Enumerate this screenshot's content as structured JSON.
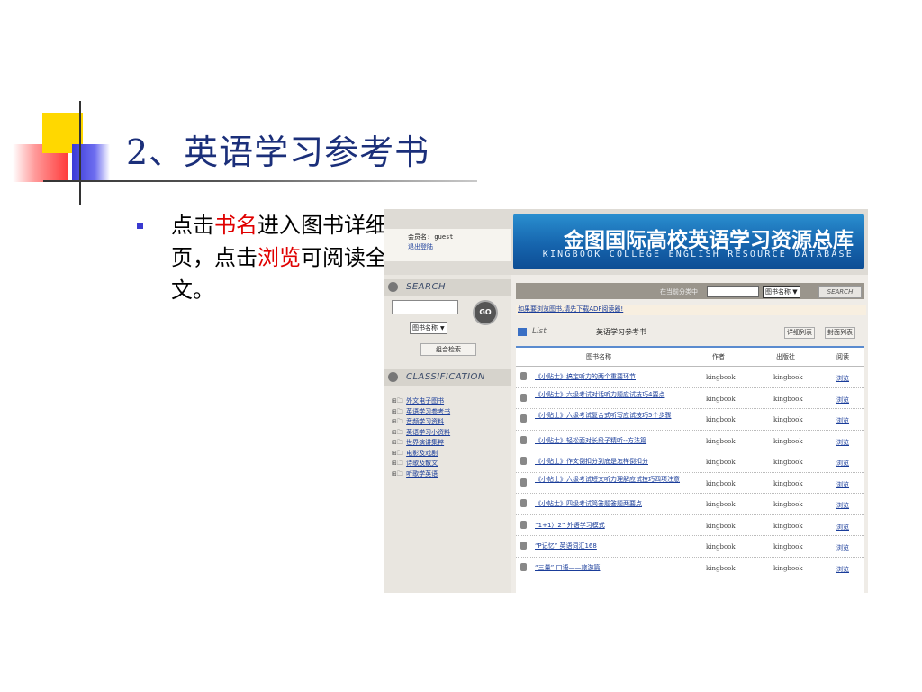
{
  "slide": {
    "title": "2、英语学习参考书",
    "bullet_pre": "点击",
    "bullet_hl1": "书名",
    "bullet_mid": "进入图书详细页，点击",
    "bullet_hl2": "浏览",
    "bullet_post": "可阅读全文。"
  },
  "header": {
    "member_label": "会员名: guest",
    "logout": "退出登陆",
    "banner_cn": "金图国际高校英语学习资源总库",
    "banner_en": "KINGBOOK COLLEGE ENGLISH RESOURCE DATABASE"
  },
  "sidebar": {
    "search_title": "SEARCH",
    "go": "GO",
    "field_select": "图书名称",
    "combo_search": "组合检索",
    "classification_title": "CLASSIFICATION",
    "tree": [
      "外文电子图书",
      "英语学习参考书",
      "音频学习资料",
      "英语学习小资料",
      "世界演讲集粹",
      "电影及戏剧",
      "诗歌及散文",
      "听歌学英语"
    ]
  },
  "main": {
    "in_category_label": "在当前分类中",
    "field_select": "图书名称",
    "search_btn": "SEARCH",
    "notice": "如果要浏览图书,请先下载ADF阅读器!",
    "list_label": "List",
    "category": "英语学习参考书",
    "view_detail": "详细列表",
    "view_cover": "封面列表",
    "columns": [
      "图书名称",
      "作者",
      "出版社",
      "阅读"
    ],
    "rows": [
      {
        "title": "《小贴士》搞定听力的两个重要环节",
        "author": "kingbook",
        "publisher": "kingbook",
        "read": "浏览"
      },
      {
        "title": "《小贴士》六级考试对话听力题应试技巧4要点",
        "author": "kingbook",
        "publisher": "kingbook",
        "read": "浏览"
      },
      {
        "title": "《小贴士》六级考试复合式听写应试技巧5个步骤",
        "author": "kingbook",
        "publisher": "kingbook",
        "read": "浏览"
      },
      {
        "title": "《小贴士》轻松面对长段子精听--方法篇",
        "author": "kingbook",
        "publisher": "kingbook",
        "read": "浏览"
      },
      {
        "title": "《小贴士》作文倒扣分到底是怎样倒扣分",
        "author": "kingbook",
        "publisher": "kingbook",
        "read": "浏览"
      },
      {
        "title": "《小帖士》六级考试短文听力理解应试技巧四项注意",
        "author": "kingbook",
        "publisher": "kingbook",
        "read": "浏览"
      },
      {
        "title": "《小帖士》四级考试简答题答题两要点",
        "author": "kingbook",
        "publisher": "kingbook",
        "read": "浏览"
      },
      {
        "title": "“1+1）2” 外语学习模式",
        "author": "kingbook",
        "publisher": "kingbook",
        "read": "浏览"
      },
      {
        "title": "“P记忆” 英语词汇168",
        "author": "kingbook",
        "publisher": "kingbook",
        "read": "浏览"
      },
      {
        "title": "“三量” 口语——旅游篇",
        "author": "kingbook",
        "publisher": "kingbook",
        "read": "浏览"
      }
    ]
  }
}
